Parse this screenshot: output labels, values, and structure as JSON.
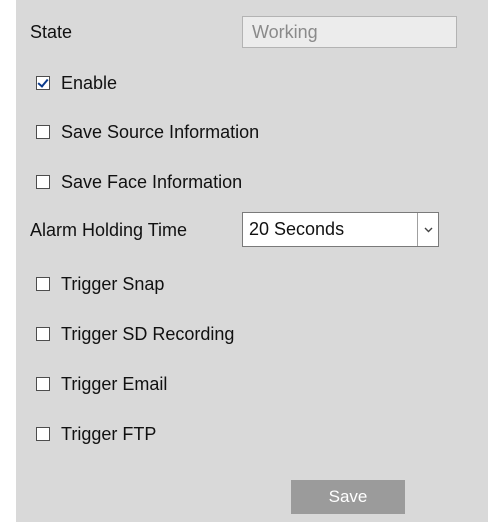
{
  "state": {
    "label": "State",
    "value": "Working"
  },
  "options": {
    "enable": {
      "label": "Enable",
      "checked": true
    },
    "save_source_information": {
      "label": "Save Source Information",
      "checked": false
    },
    "save_face_information": {
      "label": "Save Face Information",
      "checked": false
    }
  },
  "alarm_holding_time": {
    "label": "Alarm Holding Time",
    "selected": "20 Seconds",
    "arrow_icon": "chevron-down-icon"
  },
  "triggers": {
    "snap": {
      "label": "Trigger Snap",
      "checked": false
    },
    "sd_recording": {
      "label": "Trigger SD Recording",
      "checked": false
    },
    "email": {
      "label": "Trigger Email",
      "checked": false
    },
    "ftp": {
      "label": "Trigger FTP",
      "checked": false
    }
  },
  "actions": {
    "save_label": "Save"
  },
  "colors": {
    "panel_background": "#d9d9d9",
    "save_button": "#9b9b9b",
    "checkmark": "#0a3a8c"
  }
}
